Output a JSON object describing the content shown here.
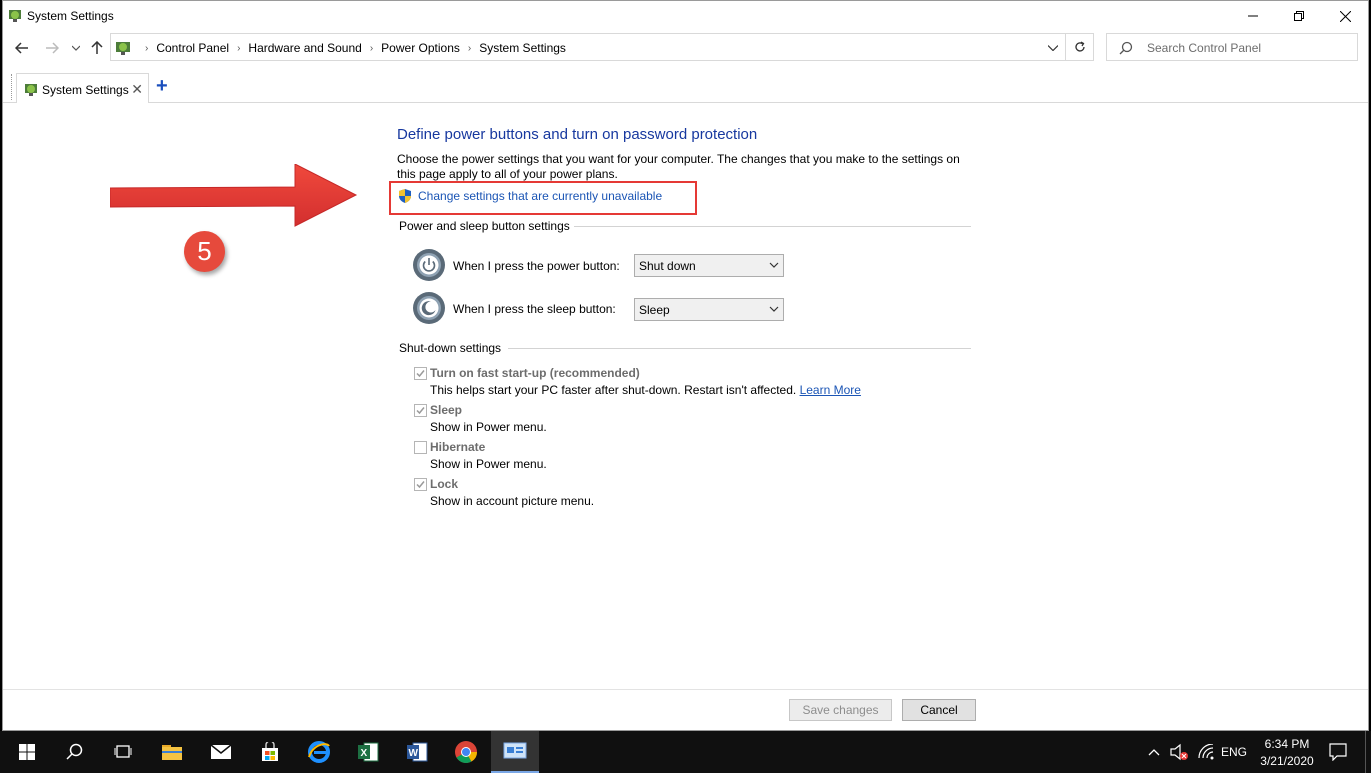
{
  "window": {
    "title": "System Settings"
  },
  "address_bar": {
    "crumbs": [
      "Control Panel",
      "Hardware and Sound",
      "Power Options",
      "System Settings"
    ],
    "search_placeholder": "Search Control Panel"
  },
  "tabs": [
    {
      "label": "System Settings"
    }
  ],
  "content": {
    "heading": "Define power buttons and turn on password protection",
    "description": "Choose the power settings that you want for your computer. The changes that you make to the settings on this page apply to all of your power plans.",
    "change_settings_link": "Change settings that are currently unavailable",
    "power_section": {
      "title": "Power and sleep button settings",
      "power_button_label": "When I press the power button:",
      "power_button_value": "Shut down",
      "sleep_button_label": "When I press the sleep button:",
      "sleep_button_value": "Sleep"
    },
    "shutdown_section": {
      "title": "Shut-down settings",
      "items": [
        {
          "label": "Turn on fast start-up (recommended)",
          "desc": "This helps start your PC faster after shut-down. Restart isn't affected. ",
          "link": "Learn More",
          "checked": true
        },
        {
          "label": "Sleep",
          "desc": "Show in Power menu.",
          "checked": true
        },
        {
          "label": "Hibernate",
          "desc": "Show in Power menu.",
          "checked": false
        },
        {
          "label": "Lock",
          "desc": "Show in account picture menu.",
          "checked": true
        }
      ]
    }
  },
  "buttons": {
    "save": "Save changes",
    "cancel": "Cancel"
  },
  "annotation": {
    "step_number": "5"
  },
  "taskbar": {
    "language": "ENG",
    "time": "6:34 PM",
    "date": "3/21/2020"
  },
  "colors": {
    "heading": "#17389f",
    "link": "#1b55b5",
    "highlight": "#e53935",
    "arrow": "#e53935",
    "badge": "#e64a3c"
  }
}
